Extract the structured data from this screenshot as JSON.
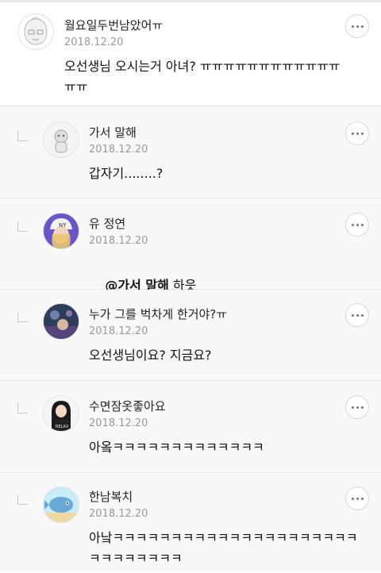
{
  "comments": [
    {
      "author": "월요일두번남았어ㅠ",
      "date": "2018.12.20",
      "text": "오선생님 오시는거 아녀? ㅠㅠㅠㅠㅠㅠㅠㅠㅠㅠㅠㅠ ㅠㅠ",
      "avatar_icon": "character-avatar-icon"
    },
    {
      "author": "가서 말해",
      "date": "2018.12.20",
      "text": "갑자기........?",
      "avatar_icon": "character-avatar-icon"
    },
    {
      "author": "유 정연",
      "date": "2018.12.20",
      "mention": "@가서 말해",
      "text": " 하읏",
      "avatar_icon": "person-avatar-icon"
    },
    {
      "author": "누가 그를 벅차게 한거야?ㅠ",
      "date": "2018.12.20",
      "text": "오선생님이요? 지금요?",
      "avatar_icon": "photo-avatar-icon"
    },
    {
      "author": "수면잠옷좋아요",
      "date": "2018.12.20",
      "text": "아옼ㅋㅋㅋㅋㅋㅋㅋㅋㅋㅋㅋㅋㅋ",
      "avatar_icon": "person-avatar-icon"
    },
    {
      "author": "한남복치",
      "date": "2018.12.20",
      "text": "아낰ㅋㅋㅋㅋㅋㅋㅋㅋㅋㅋㅋㅋㅋㅋㅋㅋㅋㅋㅋㅋㅋ ㅋㅋㅋㅋㅋㅋㅋㅋ",
      "avatar_icon": "fish-avatar-icon"
    }
  ]
}
